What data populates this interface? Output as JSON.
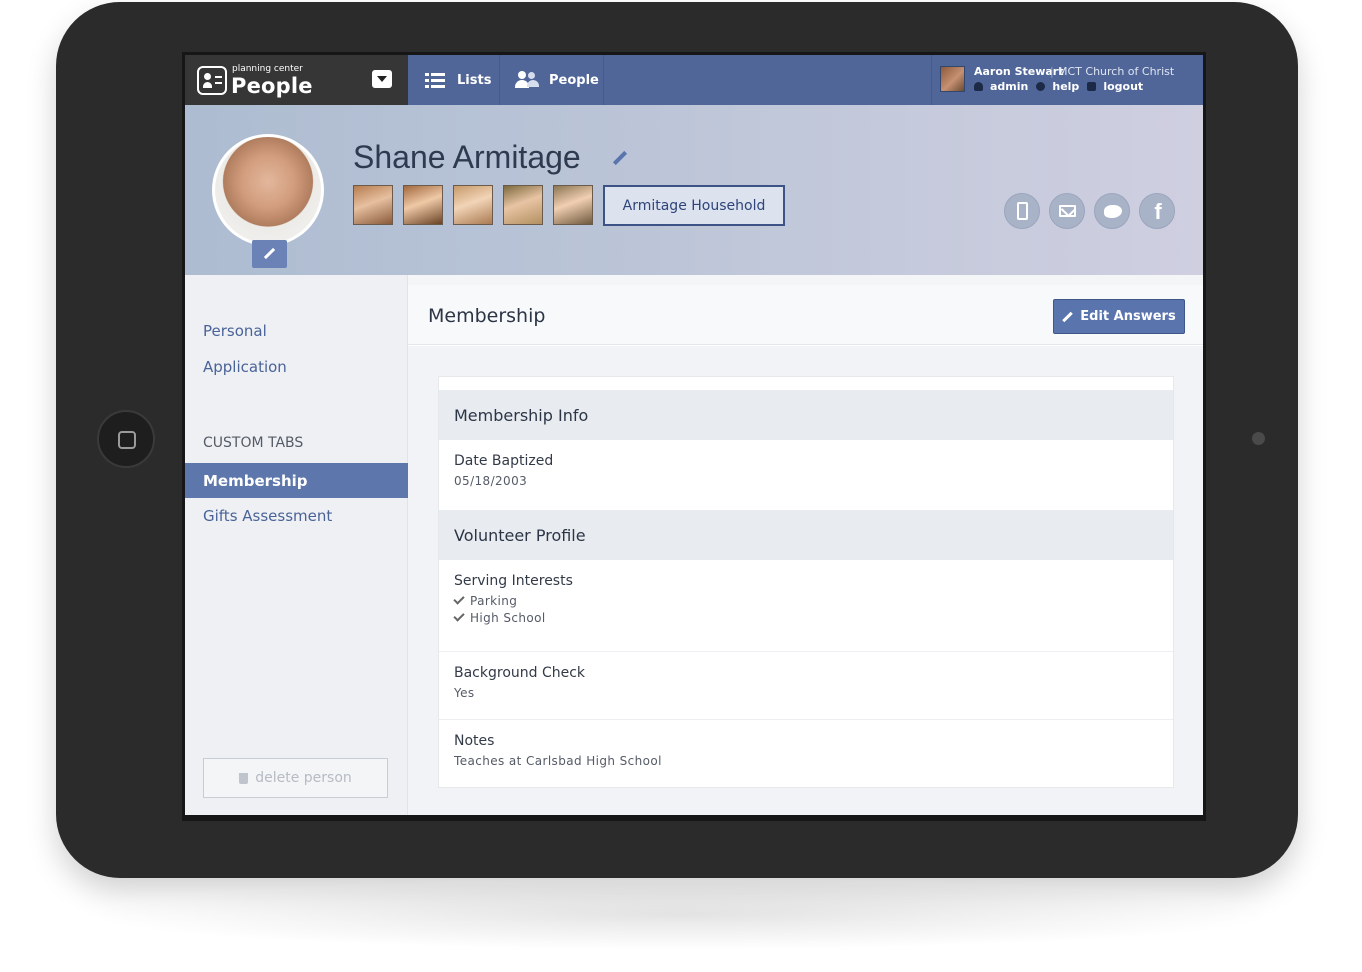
{
  "brand": {
    "small": "planning center",
    "big": "People"
  },
  "nav": {
    "lists": "Lists",
    "people": "People"
  },
  "user": {
    "name": "Aaron Stewart",
    "separator": "|",
    "church": "MCT Church of Christ",
    "admin": "admin",
    "help": "help",
    "logout": "logout"
  },
  "profile": {
    "name": "Shane Armitage",
    "household": "Armitage Household"
  },
  "sidebar": {
    "personal": "Personal",
    "application": "Application",
    "custom_tabs": "CUSTOM TABS",
    "membership": "Membership",
    "gifts": "Gifts Assessment",
    "delete": "delete person"
  },
  "main": {
    "title": "Membership",
    "edit": "Edit Answers",
    "sections": {
      "membership_info": "Membership Info",
      "volunteer_profile": "Volunteer Profile"
    },
    "fields": {
      "date_baptized": {
        "label": "Date Baptized",
        "value": "05/18/2003"
      },
      "serving": {
        "label": "Serving Interests",
        "items": [
          "Parking",
          "High School"
        ]
      },
      "background": {
        "label": "Background Check",
        "value": "Yes"
      },
      "notes": {
        "label": "Notes",
        "value": "Teaches at Carlsbad High School"
      }
    }
  },
  "colors": {
    "nav": "#506699",
    "accent": "#5a74ad",
    "brand_bg": "#363636"
  },
  "icons": [
    "list-icon",
    "people-icon",
    "pencil-icon",
    "phone-icon",
    "email-icon",
    "twitter-icon",
    "facebook-icon",
    "trash-icon",
    "check-icon"
  ]
}
